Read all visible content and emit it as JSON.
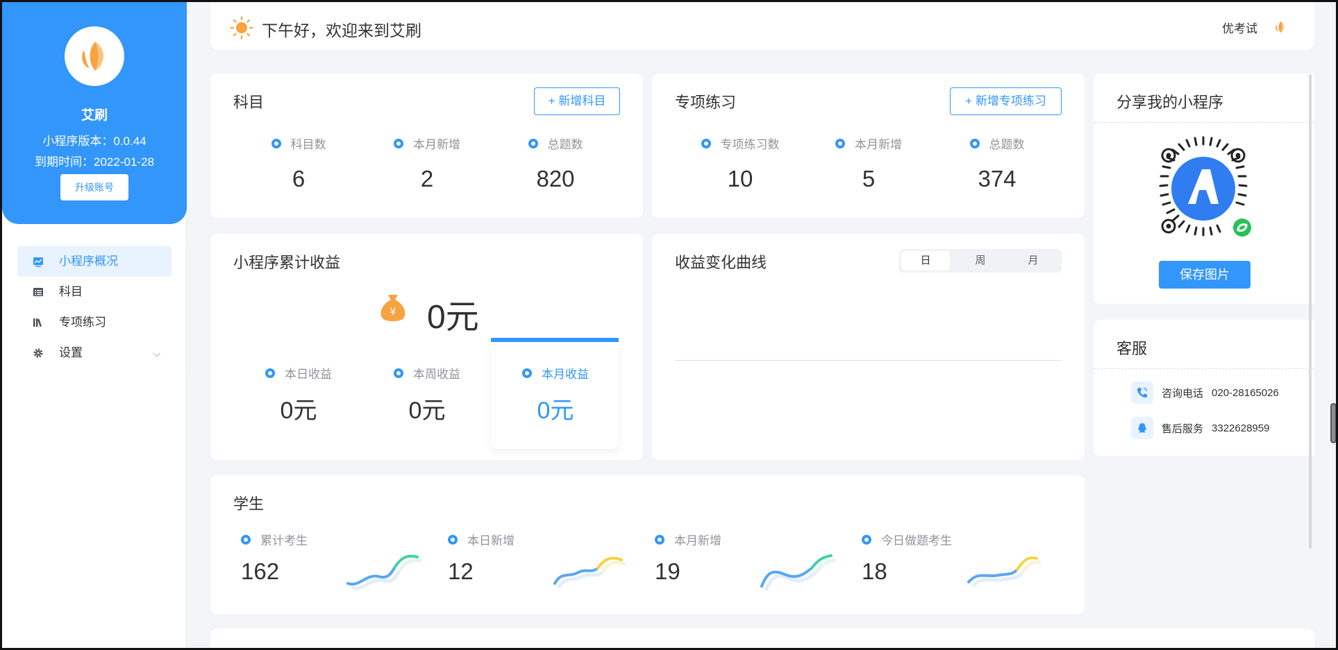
{
  "sidebar": {
    "app_name": "艾刷",
    "version": "小程序版本：0.0.44",
    "expire": "到期时间：2022-01-28",
    "upgrade_label": "升级账号",
    "menu": [
      {
        "label": "小程序概况",
        "icon": "chart-icon",
        "active": true
      },
      {
        "label": "科目",
        "icon": "list-icon",
        "active": false
      },
      {
        "label": "专项练习",
        "icon": "books-icon",
        "active": false
      },
      {
        "label": "设置",
        "icon": "gear-icon",
        "active": false
      }
    ]
  },
  "header": {
    "greeting": "下午好，欢迎来到艾刷",
    "user": "优考试"
  },
  "subjects": {
    "title": "科目",
    "add_label": "+ 新增科目",
    "stats": [
      {
        "label": "科目数",
        "value": "6"
      },
      {
        "label": "本月新增",
        "value": "2"
      },
      {
        "label": "总题数",
        "value": "820"
      }
    ]
  },
  "practice": {
    "title": "专项练习",
    "add_label": "+ 新增专项练习",
    "stats": [
      {
        "label": "专项练习数",
        "value": "10"
      },
      {
        "label": "本月新增",
        "value": "5"
      },
      {
        "label": "总题数",
        "value": "374"
      }
    ]
  },
  "earnings": {
    "title": "小程序累计收益",
    "total": "0元",
    "items": [
      {
        "label": "本日收益",
        "value": "0元"
      },
      {
        "label": "本周收益",
        "value": "0元"
      },
      {
        "label": "本月收益",
        "value": "0元"
      }
    ]
  },
  "curve": {
    "title": "收益变化曲线",
    "tabs": [
      "日",
      "周",
      "月"
    ],
    "active_tab": "日"
  },
  "students": {
    "title": "学生",
    "items": [
      {
        "label": "累计考生",
        "value": "162",
        "accent": "#42d3a0"
      },
      {
        "label": "本日新增",
        "value": "12",
        "accent": "#f7d23e"
      },
      {
        "label": "本月新增",
        "value": "19",
        "accent": "#42d3a0"
      },
      {
        "label": "今日做题考生",
        "value": "18",
        "accent": "#f7d23e"
      }
    ]
  },
  "share": {
    "title": "分享我的小程序",
    "save_label": "保存图片"
  },
  "service": {
    "title": "客服",
    "phone_label": "咨询电话",
    "phone": "020-28165026",
    "qq_label": "售后服务",
    "qq": "3322628959"
  },
  "colors": {
    "primary": "#3296fa",
    "orange": "#f6a341",
    "background": "#f3f5f8"
  }
}
